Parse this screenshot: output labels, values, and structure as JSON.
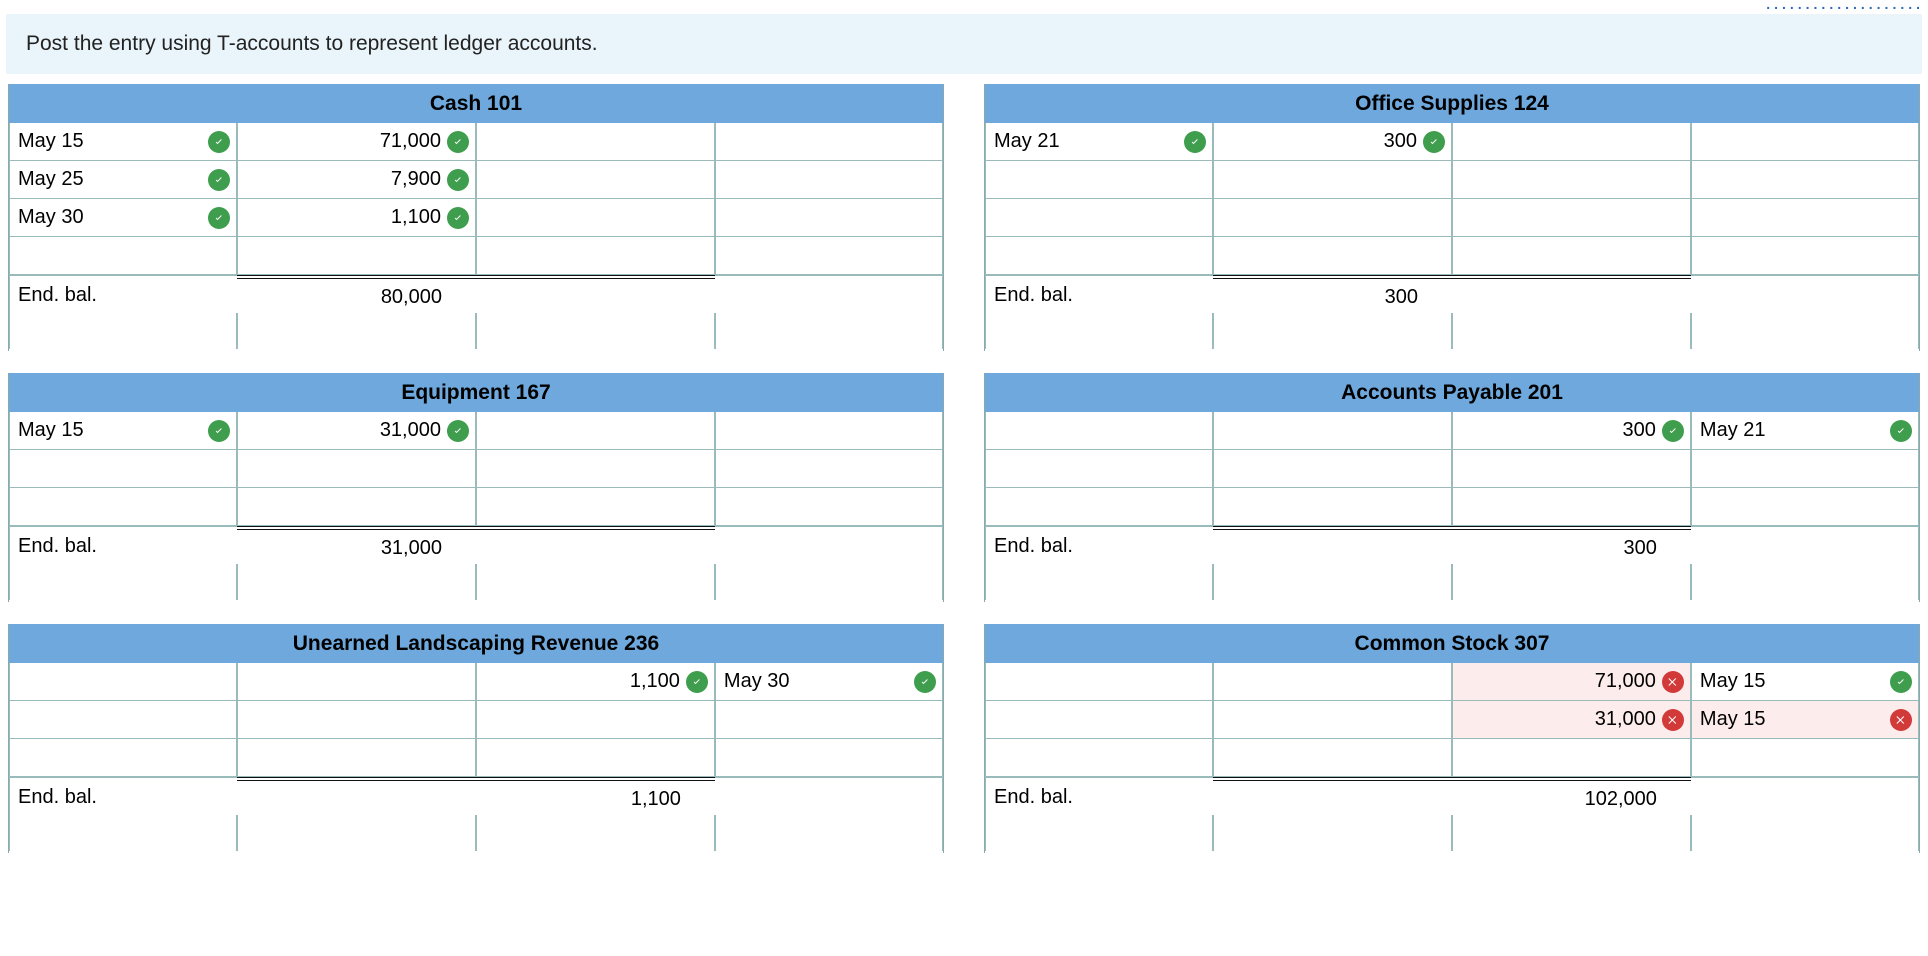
{
  "instruction": "Post the entry using T-accounts to represent ledger accounts.",
  "end_bal_label": "End. bal.",
  "accounts": [
    {
      "title": "Cash 101",
      "bal_side": "debit",
      "rows": [
        {
          "d_date": "May 15",
          "d_date_ok": true,
          "d_amt": "71,000",
          "d_amt_ok": true,
          "c_amt": "",
          "c_amt_ok": null,
          "c_date": "",
          "c_date_ok": null
        },
        {
          "d_date": "May 25",
          "d_date_ok": true,
          "d_amt": "7,900",
          "d_amt_ok": true,
          "c_amt": "",
          "c_amt_ok": null,
          "c_date": "",
          "c_date_ok": null
        },
        {
          "d_date": "May 30",
          "d_date_ok": true,
          "d_amt": "1,100",
          "d_amt_ok": true,
          "c_amt": "",
          "c_amt_ok": null,
          "c_date": "",
          "c_date_ok": null
        },
        {
          "d_date": "",
          "d_date_ok": null,
          "d_amt": "",
          "d_amt_ok": null,
          "c_amt": "",
          "c_amt_ok": null,
          "c_date": "",
          "c_date_ok": null
        }
      ],
      "bal_debit": "80,000",
      "bal_credit": ""
    },
    {
      "title": "Office Supplies 124",
      "bal_side": "debit",
      "rows": [
        {
          "d_date": "May 21",
          "d_date_ok": true,
          "d_amt": "300",
          "d_amt_ok": true,
          "c_amt": "",
          "c_amt_ok": null,
          "c_date": "",
          "c_date_ok": null
        },
        {
          "d_date": "",
          "d_date_ok": null,
          "d_amt": "",
          "d_amt_ok": null,
          "c_amt": "",
          "c_amt_ok": null,
          "c_date": "",
          "c_date_ok": null
        },
        {
          "d_date": "",
          "d_date_ok": null,
          "d_amt": "",
          "d_amt_ok": null,
          "c_amt": "",
          "c_amt_ok": null,
          "c_date": "",
          "c_date_ok": null
        },
        {
          "d_date": "",
          "d_date_ok": null,
          "d_amt": "",
          "d_amt_ok": null,
          "c_amt": "",
          "c_amt_ok": null,
          "c_date": "",
          "c_date_ok": null
        }
      ],
      "bal_debit": "300",
      "bal_credit": ""
    },
    {
      "title": "Equipment 167",
      "bal_side": "debit",
      "rows": [
        {
          "d_date": "May 15",
          "d_date_ok": true,
          "d_amt": "31,000",
          "d_amt_ok": true,
          "c_amt": "",
          "c_amt_ok": null,
          "c_date": "",
          "c_date_ok": null
        },
        {
          "d_date": "",
          "d_date_ok": null,
          "d_amt": "",
          "d_amt_ok": null,
          "c_amt": "",
          "c_amt_ok": null,
          "c_date": "",
          "c_date_ok": null
        },
        {
          "d_date": "",
          "d_date_ok": null,
          "d_amt": "",
          "d_amt_ok": null,
          "c_amt": "",
          "c_amt_ok": null,
          "c_date": "",
          "c_date_ok": null
        }
      ],
      "bal_debit": "31,000",
      "bal_credit": ""
    },
    {
      "title": "Accounts Payable 201",
      "bal_side": "credit",
      "rows": [
        {
          "d_date": "",
          "d_date_ok": null,
          "d_amt": "",
          "d_amt_ok": null,
          "c_amt": "300",
          "c_amt_ok": true,
          "c_date": "May 21",
          "c_date_ok": true
        },
        {
          "d_date": "",
          "d_date_ok": null,
          "d_amt": "",
          "d_amt_ok": null,
          "c_amt": "",
          "c_amt_ok": null,
          "c_date": "",
          "c_date_ok": null
        },
        {
          "d_date": "",
          "d_date_ok": null,
          "d_amt": "",
          "d_amt_ok": null,
          "c_amt": "",
          "c_amt_ok": null,
          "c_date": "",
          "c_date_ok": null
        }
      ],
      "bal_debit": "",
      "bal_credit": "300"
    },
    {
      "title": "Unearned Landscaping Revenue 236",
      "bal_side": "credit",
      "rows": [
        {
          "d_date": "",
          "d_date_ok": null,
          "d_amt": "",
          "d_amt_ok": null,
          "c_amt": "1,100",
          "c_amt_ok": true,
          "c_date": "May 30",
          "c_date_ok": true
        },
        {
          "d_date": "",
          "d_date_ok": null,
          "d_amt": "",
          "d_amt_ok": null,
          "c_amt": "",
          "c_amt_ok": null,
          "c_date": "",
          "c_date_ok": null
        },
        {
          "d_date": "",
          "d_date_ok": null,
          "d_amt": "",
          "d_amt_ok": null,
          "c_amt": "",
          "c_amt_ok": null,
          "c_date": "",
          "c_date_ok": null
        }
      ],
      "bal_debit": "",
      "bal_credit": "1,100"
    },
    {
      "title": "Common Stock 307",
      "bal_side": "credit",
      "rows": [
        {
          "d_date": "",
          "d_date_ok": null,
          "d_amt": "",
          "d_amt_ok": null,
          "c_amt": "71,000",
          "c_amt_ok": false,
          "c_date": "May 15",
          "c_date_ok": true
        },
        {
          "d_date": "",
          "d_date_ok": null,
          "d_amt": "",
          "d_amt_ok": null,
          "c_amt": "31,000",
          "c_amt_ok": false,
          "c_date": "May 15",
          "c_date_ok": false
        },
        {
          "d_date": "",
          "d_date_ok": null,
          "d_amt": "",
          "d_amt_ok": null,
          "c_amt": "",
          "c_amt_ok": null,
          "c_date": "",
          "c_date_ok": null
        }
      ],
      "bal_debit": "",
      "bal_credit": "102,000"
    }
  ]
}
